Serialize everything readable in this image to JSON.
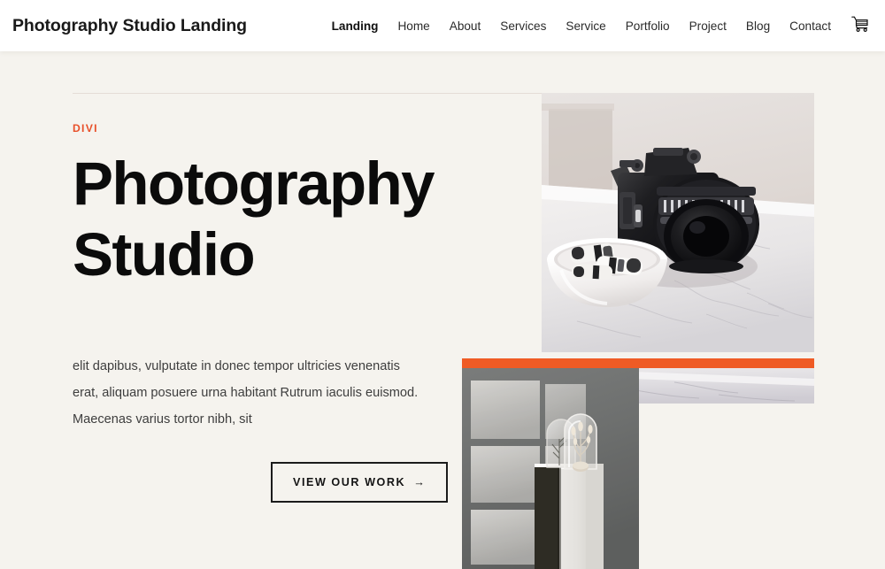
{
  "theme": {
    "page_background": "#f5f3ee",
    "header_background": "#ffffff",
    "accent_color": "#ef5b25",
    "eyebrow_color": "#e8502a",
    "heading_color": "#0b0b0b",
    "body_text_color": "#3e3e3e"
  },
  "header": {
    "logo_text": "Photography Studio Landing",
    "nav_items": [
      {
        "label": "Landing",
        "active": true
      },
      {
        "label": "Home",
        "active": false
      },
      {
        "label": "About",
        "active": false
      },
      {
        "label": "Services",
        "active": false
      },
      {
        "label": "Service",
        "active": false
      },
      {
        "label": "Portfolio",
        "active": false
      },
      {
        "label": "Project",
        "active": false
      },
      {
        "label": "Blog",
        "active": false
      },
      {
        "label": "Contact",
        "active": false
      }
    ],
    "cart_icon": "shopping-cart-icon"
  },
  "hero": {
    "eyebrow": "DIVI",
    "title_line_1": "Photography",
    "title_line_2": "Studio",
    "paragraph": "elit dapibus, vulputate in donec tempor ultricies venenatis erat, aliquam posuere urna habitant Rutrum iaculis euismod. Maecenas varius tortor nibh, sit",
    "cta_label": "VIEW OUR WORK",
    "cta_arrow": "→",
    "images": {
      "top": {
        "alt": "Vintage film camera on a white marble surface next to a ceramic bowl holding rolls of 35mm film"
      },
      "bottom": {
        "alt": "Glass cloche with dried flowers on a white pedestal, window light shadows cast on a grey wall"
      }
    }
  }
}
